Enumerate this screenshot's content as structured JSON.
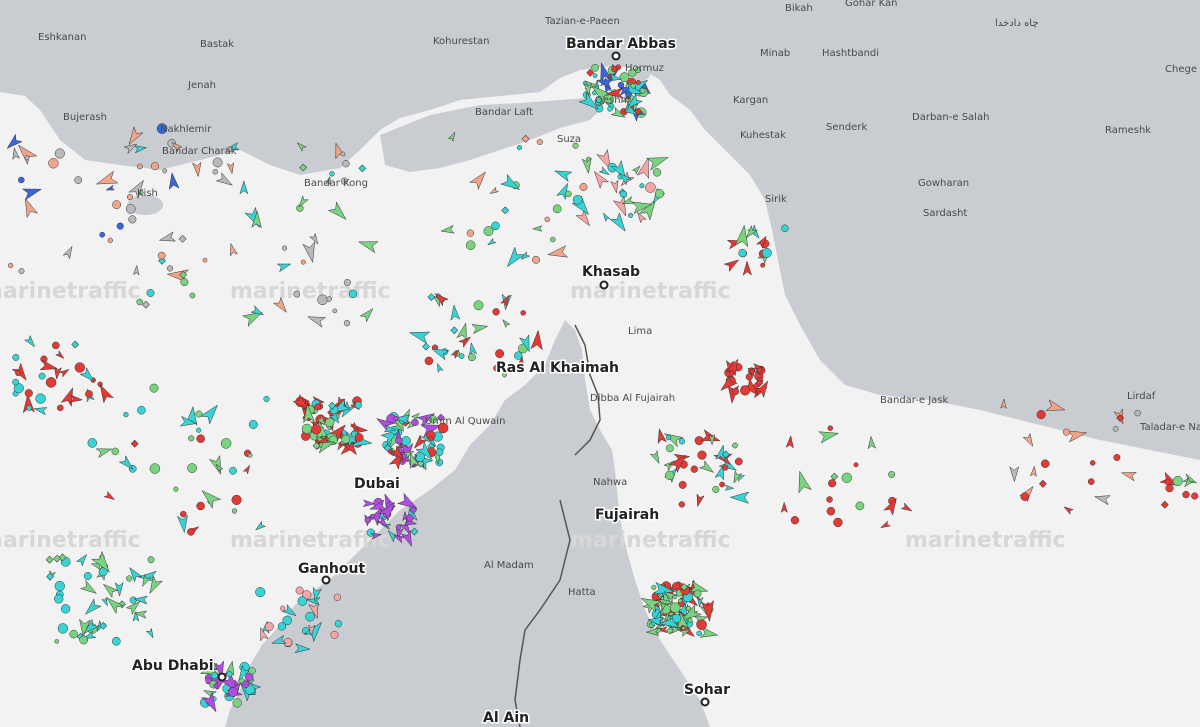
{
  "watermark": "marinetraffic",
  "colors": {
    "sea": "#f2f2f2",
    "land": "#c9ccd0",
    "border": "#555555",
    "cargo": "#79d47f",
    "tanker": "#e53935",
    "passenger": "#3a67d8",
    "tug": "#36d4d4",
    "fishing": "#f0a58a",
    "pleasure": "#b04de0",
    "unknown": "#b9b9b9",
    "station": "#f6a6a6"
  },
  "places": [
    {
      "name": "Tazian-e-Paeen"
    },
    {
      "name": "Bikah"
    },
    {
      "name": "Gohar Kan"
    },
    {
      "name": "چاه دادخدا"
    },
    {
      "name": "Eshkanan"
    },
    {
      "name": "Bastak"
    },
    {
      "name": "Kohurestan"
    },
    {
      "name": "Minab"
    },
    {
      "name": "Hashtbandi"
    },
    {
      "name": "Chege"
    },
    {
      "name": "Jenah"
    },
    {
      "name": "Hormuz"
    },
    {
      "name": "Qeshm"
    },
    {
      "name": "Kargan"
    },
    {
      "name": "Bujerash"
    },
    {
      "name": "Nakhlemir"
    },
    {
      "name": "Bandar Laft"
    },
    {
      "name": "Kuhestak"
    },
    {
      "name": "Senderk"
    },
    {
      "name": "Darban-e Salah"
    },
    {
      "name": "Rameshk"
    },
    {
      "name": "Bandar Charak"
    },
    {
      "name": "Suza"
    },
    {
      "name": "Kish"
    },
    {
      "name": "Bandar Kong"
    },
    {
      "name": "Gowharan"
    },
    {
      "name": "Sirik"
    },
    {
      "name": "Sardasht"
    },
    {
      "name": "Lima"
    },
    {
      "name": "Dibba Al Fujairah"
    },
    {
      "name": "Bandar-e Jask"
    },
    {
      "name": "Lirdaf"
    },
    {
      "name": "Taladar-e Nakhlestan"
    },
    {
      "name": "Umm Al Quwain"
    },
    {
      "name": "Nahwa"
    },
    {
      "name": "Al Madam"
    },
    {
      "name": "Hatta"
    }
  ],
  "cities": [
    {
      "name": "Bandar Abbas"
    },
    {
      "name": "Khasab"
    },
    {
      "name": "Ras Al Khaimah"
    },
    {
      "name": "Dubai"
    },
    {
      "name": "Fujairah"
    },
    {
      "name": "Ganhout"
    },
    {
      "name": "Abu Dhabi"
    },
    {
      "name": "Sohar"
    },
    {
      "name": "Al Ain"
    }
  ]
}
